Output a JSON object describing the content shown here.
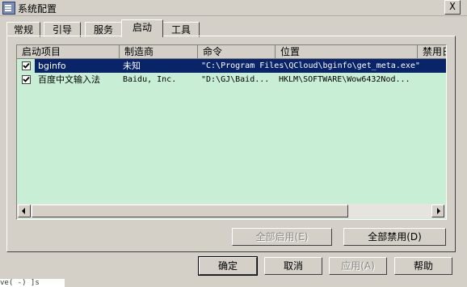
{
  "window": {
    "title": "系统配置",
    "close_label": "X"
  },
  "tabs": [
    {
      "label": "常规"
    },
    {
      "label": "引导"
    },
    {
      "label": "服务"
    },
    {
      "label": "启动",
      "active": true
    },
    {
      "label": "工具"
    }
  ],
  "list": {
    "columns": [
      "启动项目",
      "制造商",
      "命令",
      "位置",
      "禁用日"
    ],
    "rows": [
      {
        "checked": true,
        "selected": true,
        "item": "bginfo",
        "maker": "未知",
        "command": "\"C:\\Program Files\\QCloud\\bginfo\\get_meta.exe\"",
        "location": "",
        "disabled": ""
      },
      {
        "checked": true,
        "selected": false,
        "item": "百度中文输入法",
        "maker": "Baidu, Inc.",
        "command": "\"D:\\GJ\\Baid...",
        "location": "HKLM\\SOFTWARE\\Wow6432Nod...",
        "disabled": ""
      }
    ]
  },
  "buttons": {
    "enable_all": "全部启用(E)",
    "disable_all": "全部禁用(D)",
    "ok": "确定",
    "cancel": "取消",
    "apply": "应用(A)",
    "help": "帮助"
  },
  "taskbar_fragment": "ve( -) ]s",
  "colors": {
    "list_bg": "#c8eed6",
    "selection": "#0a246a",
    "face": "#d4d0c8"
  }
}
